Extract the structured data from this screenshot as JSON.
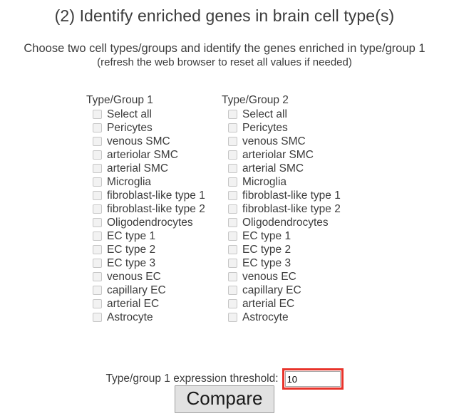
{
  "header": {
    "title": "(2) Identify enriched genes in brain cell type(s)",
    "subtitle_line_1": "Choose two cell types/groups and identify the genes enriched in type/group 1",
    "subtitle_line_2": "(refresh the web browser to reset all values if needed)"
  },
  "columns": [
    {
      "header": "Type/Group 1",
      "options": [
        "Select all",
        "Pericytes",
        "venous SMC",
        "arteriolar SMC",
        "arterial SMC",
        "Microglia",
        "fibroblast-like type 1",
        "fibroblast-like type 2",
        "Oligodendrocytes",
        "EC type 1",
        "EC type 2",
        "EC type 3",
        "venous EC",
        "capillary EC",
        "arterial EC",
        "Astrocyte"
      ]
    },
    {
      "header": "Type/Group 2",
      "options": [
        "Select all",
        "Pericytes",
        "venous SMC",
        "arteriolar SMC",
        "arterial SMC",
        "Microglia",
        "fibroblast-like type 1",
        "fibroblast-like type 2",
        "Oligodendrocytes",
        "EC type 1",
        "EC type 2",
        "EC type 3",
        "venous EC",
        "capillary EC",
        "arterial EC",
        "Astrocyte"
      ]
    }
  ],
  "threshold": {
    "label": "Type/group 1 expression threshold:",
    "value": "10",
    "placeholder": "",
    "highlight_color": "#e8332a"
  },
  "actions": {
    "compare_label": "Compare"
  }
}
